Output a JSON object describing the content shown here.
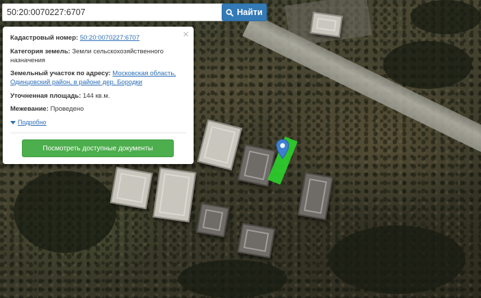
{
  "search": {
    "value": "50:20:0070227:6707",
    "button_label": "Найти",
    "button_icon": "search-icon"
  },
  "popup": {
    "close_symbol": "×",
    "cadastral_label": "Кадастровый номер:",
    "cadastral_value": "50:20:0070227:6707",
    "category_label": "Категория земель:",
    "category_value": "Земли сельскохозяйственного назначения",
    "address_label": "Земельный участок по адресу:",
    "address_value": "Московская область, Одинцовский район, в районе дер. Бородки",
    "area_label": "Уточненная площадь:",
    "area_value": "144 кв.м.",
    "survey_label": "Межевание:",
    "survey_value": "Проведено",
    "more_label": "Подробно",
    "docs_button_label": "Посмотреть доступные документы"
  },
  "colors": {
    "primary_button": "#337ab7",
    "success_button": "#4cae4c",
    "link": "#2a6db8",
    "plot_highlight": "#2cd32c",
    "marker": "#3d7fd1"
  }
}
